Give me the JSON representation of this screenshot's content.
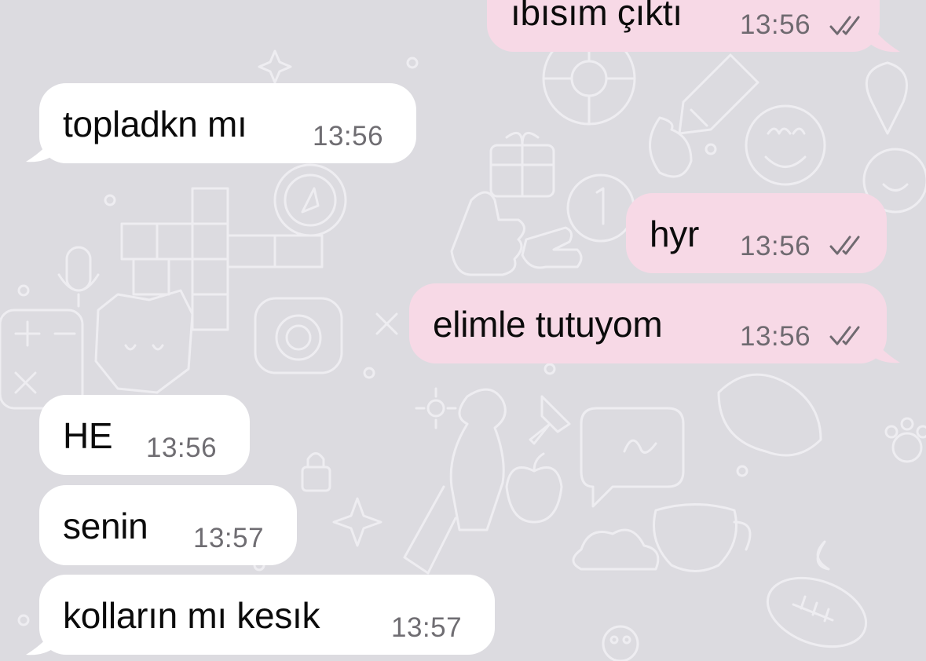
{
  "chat": {
    "theme": {
      "wallpaper_color": "#dcdbe0",
      "incoming_bubble_color": "#ffffff",
      "outgoing_bubble_color": "#f7d9e6",
      "timestamp_color": "#6f6d72"
    },
    "messages": [
      {
        "direction": "outgoing",
        "text": "ıbısım çıktı",
        "time": "13:56",
        "status": "read-ticks-icon"
      },
      {
        "direction": "incoming",
        "text": "topladkn mı",
        "time": "13:56"
      },
      {
        "direction": "outgoing",
        "text": "hyr",
        "time": "13:56",
        "status": "read-ticks-icon"
      },
      {
        "direction": "outgoing",
        "text": "elimle tutuyom",
        "time": "13:56",
        "status": "read-ticks-icon"
      },
      {
        "direction": "incoming",
        "text": "HE",
        "time": "13:56"
      },
      {
        "direction": "incoming",
        "text": "senin",
        "time": "13:57"
      },
      {
        "direction": "incoming",
        "text": "kolların mı kesık",
        "time": "13:57"
      }
    ]
  }
}
